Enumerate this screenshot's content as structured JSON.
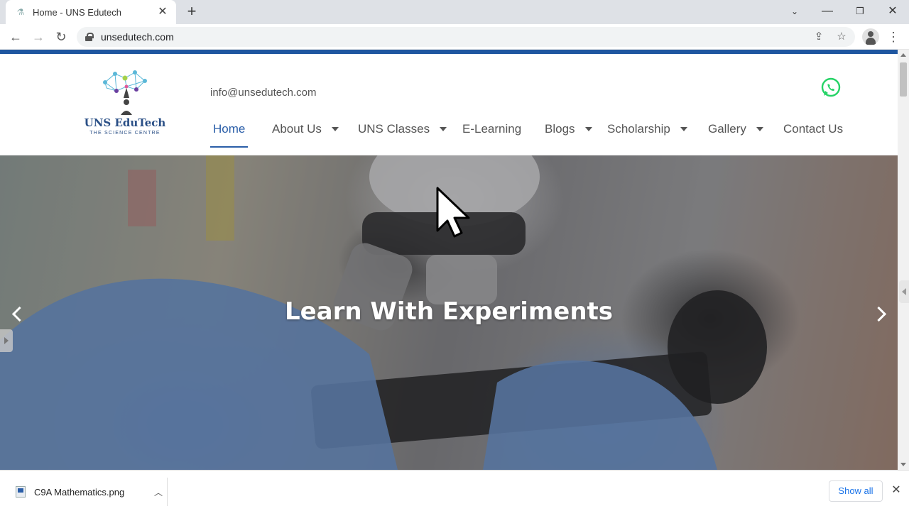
{
  "browser": {
    "tab_title": "Home - UNS Edutech",
    "url": "unsedutech.com"
  },
  "site": {
    "logo_title": "UNS EduTech",
    "logo_subtitle": "THE SCIENCE CENTRE",
    "email": "info@unsedutech.com",
    "nav": [
      {
        "label": "Home",
        "active": true,
        "dropdown": false
      },
      {
        "label": "About Us",
        "active": false,
        "dropdown": true
      },
      {
        "label": "UNS Classes",
        "active": false,
        "dropdown": true
      },
      {
        "label": "E-Learning",
        "active": false,
        "dropdown": false
      },
      {
        "label": "Blogs",
        "active": false,
        "dropdown": true
      },
      {
        "label": "Scholarship",
        "active": false,
        "dropdown": true
      },
      {
        "label": "Gallery",
        "active": false,
        "dropdown": true
      },
      {
        "label": "Contact Us",
        "active": false,
        "dropdown": false
      }
    ]
  },
  "hero": {
    "heading": "Learn With Experiments"
  },
  "downloads": {
    "file_name": "C9A Mathematics.png",
    "show_all_label": "Show all"
  },
  "colors": {
    "brand_blue": "#2a5ea8",
    "top_stripe": "#1e56a0",
    "whatsapp_green": "#25d366",
    "link_blue": "#1a73e8"
  },
  "icons": {
    "favicon": "flask-icon",
    "whatsapp": "whatsapp-icon"
  }
}
